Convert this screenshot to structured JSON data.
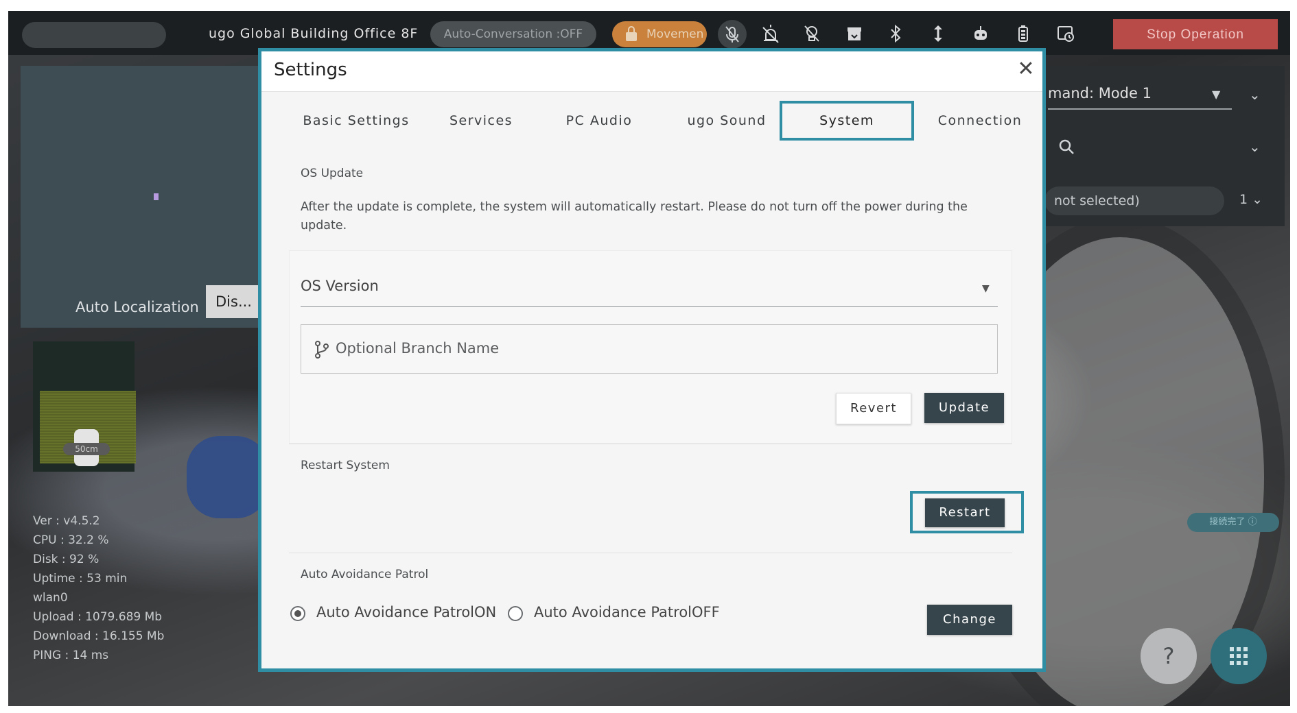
{
  "topbar": {
    "site_name": "ugo Global Building Office 8F",
    "auto_conversation": "Auto-Conversation :OFF",
    "movement": "Movemen",
    "stop_operation": "Stop Operation",
    "icons": [
      "mic-off-icon",
      "alarm-off-icon",
      "light-off-icon",
      "archive-icon",
      "bluetooth-icon",
      "height-icon",
      "robot-icon",
      "battery-icon",
      "history-icon"
    ]
  },
  "left_panel": {
    "auto_localization_label": "Auto Localization",
    "auto_localization_value": "Dis...",
    "scale_label": "50cm",
    "stats": [
      "Ver : v4.5.2",
      "CPU : 32.2 %",
      "Disk : 92 %",
      "Uptime : 53 min",
      "wlan0",
      "Upload : 1079.689 Mb",
      "Download : 16.155 Mb",
      "PING : 14 ms"
    ]
  },
  "right_panel": {
    "command_mode": "mand: Mode 1",
    "selection_text": "not selected)",
    "count": "1"
  },
  "connection_badge": "接続完了",
  "modal": {
    "title": "Settings",
    "tabs": [
      {
        "label": "Basic Settings"
      },
      {
        "label": "Services"
      },
      {
        "label": "PC Audio"
      },
      {
        "label": "ugo Sound"
      },
      {
        "label": "System"
      },
      {
        "label": "Connection"
      }
    ],
    "os_update": {
      "title": "OS Update",
      "description": "After the update is complete, the system will automatically restart. Please do not turn off the power during the update.",
      "version_label": "OS Version",
      "branch_placeholder": "Optional Branch Name",
      "revert_label": "Revert",
      "update_label": "Update"
    },
    "restart": {
      "title": "Restart System",
      "button_label": "Restart"
    },
    "auto_avoidance": {
      "title": "Auto Avoidance Patrol",
      "option_on": "Auto Avoidance PatrolON",
      "option_off": "Auto Avoidance PatrolOFF",
      "selected": "on",
      "change_label": "Change"
    }
  },
  "colors": {
    "accent": "#2f8ea3",
    "dark_button": "#36454c",
    "stop_button": "#b84b48"
  }
}
